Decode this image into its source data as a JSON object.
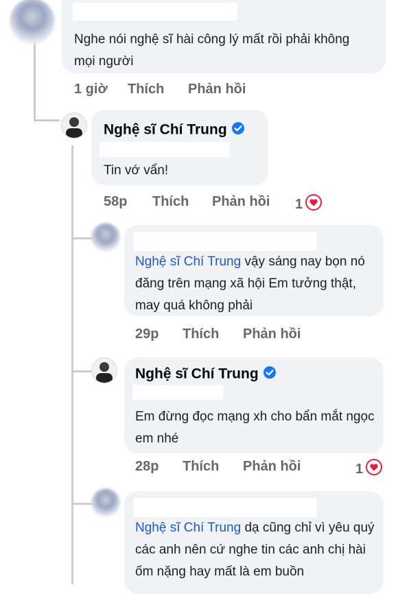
{
  "comments": [
    {
      "author": "",
      "text": "Nghe nói nghệ sĩ hài công lý mất rồi phải không mọi người",
      "time": "1 giờ",
      "like": "Thích",
      "reply": "Phản hồi"
    },
    {
      "author": "Nghệ sĩ Chí Trung",
      "text": "Tin vớ vẩn!",
      "time": "58p",
      "like": "Thích",
      "reply": "Phản hồi",
      "reaction_count": "1"
    },
    {
      "mention": "Nghệ sĩ Chí Trung",
      "text": " vậy sáng nay bọn nó đăng trên mạng xã hội Em tưởng thật, may quá không phải",
      "time": "29p",
      "like": "Thích",
      "reply": "Phản hồi"
    },
    {
      "author": "Nghệ sĩ Chí Trung",
      "text": "Em đừng đọc mạng xh cho bẩn mắt ngọc em nhé",
      "time": "28p",
      "like": "Thích",
      "reply": "Phản hồi",
      "reaction_count": "1"
    },
    {
      "mention": "Nghệ sĩ Chí Trung",
      "text": " dạ cũng chỉ vì yêu quý các anh nên cứ nghe tin các anh chị hài ốm nặng hay mất là em buồn"
    }
  ],
  "colors": {
    "bubble": "#f0f2f5",
    "mention": "#2059c4",
    "meta": "#65676b",
    "verified": "#1877f2",
    "heart": "#e41e3f"
  },
  "icons": {
    "verified": "verified-badge-icon",
    "reaction": "heart-icon"
  }
}
